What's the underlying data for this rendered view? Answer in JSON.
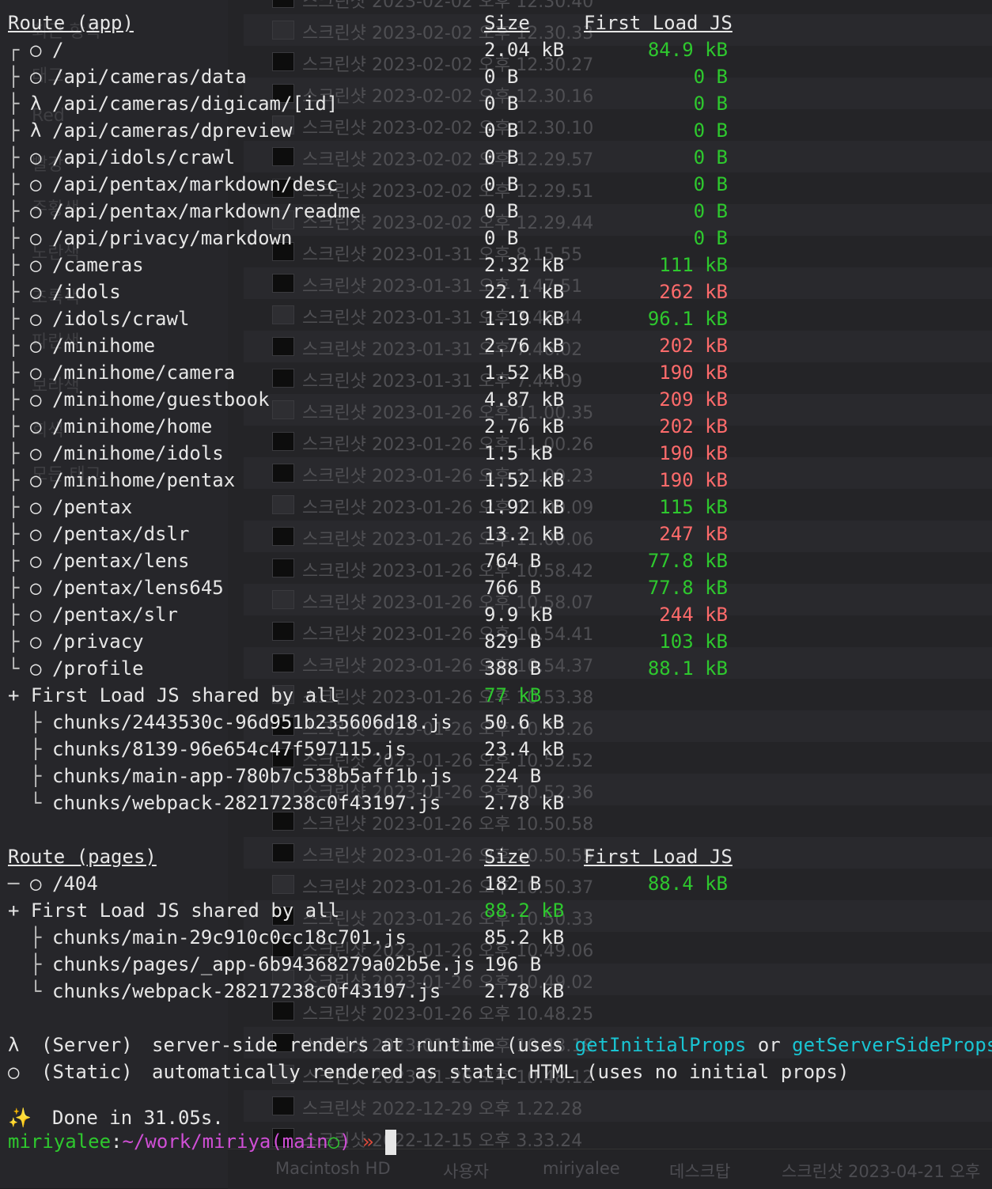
{
  "background_finder": {
    "rows": [
      "스크린샷 2023-02-02 오후 12.30.40",
      "스크린샷 2023-02-02 오후 12.30.33",
      "스크린샷 2023-02-02 오후 12.30.27",
      "스크린샷 2023-02-02 오후 12.30.16",
      "스크린샷 2023-02-02 오후 12.30.10",
      "스크린샷 2023-02-02 오후 12.29.57",
      "스크린샷 2023-02-02 오후 12.29.51",
      "스크린샷 2023-02-02 오후 12.29.44",
      "스크린샷 2023-01-31 오후 8.15.55",
      "스크린샷 2023-01-31 오후 7.47.51",
      "스크린샷 2023-01-31 오후 7.46.44",
      "스크린샷 2023-01-31 오후 7.46.02",
      "스크린샷 2023-01-31 오후 7.44.09",
      "스크린샷 2023-01-26 오후 11.00.35",
      "스크린샷 2023-01-26 오후 11.00.26",
      "스크린샷 2023-01-26 오후 11.00.23",
      "스크린샷 2023-01-26 오후 11.00.09",
      "스크린샷 2023-01-26 오후 11.00.06",
      "스크린샷 2023-01-26 오후 10.58.42",
      "스크린샷 2023-01-26 오후 10.58.07",
      "스크린샷 2023-01-26 오후 10.54.41",
      "스크린샷 2023-01-26 오후 10.54.37",
      "스크린샷 2023-01-26 오후 10.53.38",
      "스크린샷 2023-01-26 오후 10.53.26",
      "스크린샷 2023-01-26 오후 10.52.52",
      "스크린샷 2023-01-26 오후 10.52.36",
      "스크린샷 2023-01-26 오후 10.50.58",
      "스크린샷 2023-01-26 오후 10.50.55",
      "스크린샷 2023-01-26 오후 10.50.37",
      "스크린샷 2023-01-26 오후 10.50.33",
      "스크린샷 2023-01-26 오후 10.49.06",
      "스크린샷 2023-01-26 오후 10.49.02",
      "스크린샷 2023-01-26 오후 10.48.25",
      "스크린샷 2023-01-26 오후 10.48.18",
      "스크린샷 2023-01-26 오후 10.48.12",
      "스크린샷 2022-12-29 오후 1.22.28",
      "스크린샷 2022-12-15 오후 3.33.24"
    ],
    "sidebar_items": [
      "최근 항목",
      "태그",
      "Red",
      "빨강",
      "주황색",
      "노란색",
      "초록색",
      "파란색",
      "보라색",
      "회색",
      "모든 태그"
    ],
    "path_bar": [
      "Macintosh HD",
      "사용자",
      "miriyalee",
      "데스크탑",
      "스크린샷 2023-04-21 오후"
    ]
  },
  "app_section": {
    "header": {
      "route": "Route (app)",
      "size": "Size",
      "first_load": "First Load JS"
    },
    "routes": [
      {
        "tree": "┌",
        "sym": "○",
        "path": "/",
        "size": "2.04 kB",
        "first": "84.9 kB",
        "color": "#2ec82e"
      },
      {
        "tree": "├",
        "sym": "○",
        "path": "/api/cameras/data",
        "size": "0 B",
        "first": "0 B",
        "color": "#2ec82e"
      },
      {
        "tree": "├",
        "sym": "λ",
        "path": "/api/cameras/digicam/[id]",
        "size": "0 B",
        "first": "0 B",
        "color": "#2ec82e"
      },
      {
        "tree": "├",
        "sym": "λ",
        "path": "/api/cameras/dpreview",
        "size": "0 B",
        "first": "0 B",
        "color": "#2ec82e"
      },
      {
        "tree": "├",
        "sym": "○",
        "path": "/api/idols/crawl",
        "size": "0 B",
        "first": "0 B",
        "color": "#2ec82e"
      },
      {
        "tree": "├",
        "sym": "○",
        "path": "/api/pentax/markdown/desc",
        "size": "0 B",
        "first": "0 B",
        "color": "#2ec82e"
      },
      {
        "tree": "├",
        "sym": "○",
        "path": "/api/pentax/markdown/readme",
        "size": "0 B",
        "first": "0 B",
        "color": "#2ec82e"
      },
      {
        "tree": "├",
        "sym": "○",
        "path": "/api/privacy/markdown",
        "size": "0 B",
        "first": "0 B",
        "color": "#2ec82e"
      },
      {
        "tree": "├",
        "sym": "○",
        "path": "/cameras",
        "size": "2.32 kB",
        "first": "111 kB",
        "color": "#2ec82e"
      },
      {
        "tree": "├",
        "sym": "○",
        "path": "/idols",
        "size": "22.1 kB",
        "first": "262 kB",
        "color": "#ff6b6b"
      },
      {
        "tree": "├",
        "sym": "○",
        "path": "/idols/crawl",
        "size": "1.19 kB",
        "first": "96.1 kB",
        "color": "#2ec82e"
      },
      {
        "tree": "├",
        "sym": "○",
        "path": "/minihome",
        "size": "2.76 kB",
        "first": "202 kB",
        "color": "#ff6b6b"
      },
      {
        "tree": "├",
        "sym": "○",
        "path": "/minihome/camera",
        "size": "1.52 kB",
        "first": "190 kB",
        "color": "#ff6b6b"
      },
      {
        "tree": "├",
        "sym": "○",
        "path": "/minihome/guestbook",
        "size": "4.87 kB",
        "first": "209 kB",
        "color": "#ff6b6b"
      },
      {
        "tree": "├",
        "sym": "○",
        "path": "/minihome/home",
        "size": "2.76 kB",
        "first": "202 kB",
        "color": "#ff6b6b"
      },
      {
        "tree": "├",
        "sym": "○",
        "path": "/minihome/idols",
        "size": "1.5 kB",
        "first": "190 kB",
        "color": "#ff6b6b"
      },
      {
        "tree": "├",
        "sym": "○",
        "path": "/minihome/pentax",
        "size": "1.52 kB",
        "first": "190 kB",
        "color": "#ff6b6b"
      },
      {
        "tree": "├",
        "sym": "○",
        "path": "/pentax",
        "size": "1.92 kB",
        "first": "115 kB",
        "color": "#2ec82e"
      },
      {
        "tree": "├",
        "sym": "○",
        "path": "/pentax/dslr",
        "size": "13.2 kB",
        "first": "247 kB",
        "color": "#ff6b6b"
      },
      {
        "tree": "├",
        "sym": "○",
        "path": "/pentax/lens",
        "size": "764 B",
        "first": "77.8 kB",
        "color": "#2ec82e"
      },
      {
        "tree": "├",
        "sym": "○",
        "path": "/pentax/lens645",
        "size": "766 B",
        "first": "77.8 kB",
        "color": "#2ec82e"
      },
      {
        "tree": "├",
        "sym": "○",
        "path": "/pentax/slr",
        "size": "9.9 kB",
        "first": "244 kB",
        "color": "#ff6b6b"
      },
      {
        "tree": "├",
        "sym": "○",
        "path": "/privacy",
        "size": "829 B",
        "first": "103 kB",
        "color": "#2ec82e"
      },
      {
        "tree": "└",
        "sym": "○",
        "path": "/profile",
        "size": "388 B",
        "first": "88.1 kB",
        "color": "#2ec82e"
      }
    ],
    "shared": {
      "label": "+ First Load JS shared by all",
      "size": "77 kB"
    },
    "chunks": [
      {
        "tree": "├",
        "name": "chunks/2443530c-96d951b235606d18.js",
        "size": "50.6 kB"
      },
      {
        "tree": "├",
        "name": "chunks/8139-96e654c47f597115.js",
        "size": "23.4 kB"
      },
      {
        "tree": "├",
        "name": "chunks/main-app-780b7c538b5aff1b.js",
        "size": "224 B"
      },
      {
        "tree": "└",
        "name": "chunks/webpack-28217238c0f43197.js",
        "size": "2.78 kB"
      }
    ]
  },
  "pages_section": {
    "header": {
      "route": "Route (pages)",
      "size": "Size",
      "first_load": "First Load JS"
    },
    "routes": [
      {
        "tree": "─",
        "sym": "○",
        "path": "/404",
        "size": "182 B",
        "first": "88.4 kB",
        "color": "#2ec82e"
      }
    ],
    "shared": {
      "label": "+ First Load JS shared by all",
      "size": "88.2 kB"
    },
    "chunks": [
      {
        "tree": "├",
        "name": "chunks/main-29c910c0cc18c701.js",
        "size": "85.2 kB"
      },
      {
        "tree": "├",
        "name": "chunks/pages/_app-6b94368279a02b5e.js",
        "size": "196 B"
      },
      {
        "tree": "└",
        "name": "chunks/webpack-28217238c0f43197.js",
        "size": "2.78 kB"
      }
    ]
  },
  "legend": {
    "server_sym": "λ",
    "server_label": "(Server)",
    "server_text_a": "server-side renders at runtime (uses ",
    "server_fn1": "getInitialProps",
    "server_text_b": " or ",
    "server_fn2": "getServerSideProps",
    "server_text_c": ")",
    "static_sym": "○",
    "static_label": "(Static)",
    "static_text": "automatically rendered as static HTML (uses no initial props)"
  },
  "done": {
    "icon": "✨",
    "text": "Done in 31.05s."
  },
  "prompt": {
    "user": "miriyalee",
    "sep": ":",
    "path": "~/work/miriya",
    "branch_open": "(",
    "branch": "main",
    "branch_mark": "○",
    "branch_close": ")",
    "arrow": "»"
  },
  "colors": {
    "ok": "#2ec82e",
    "warn": "#ff6b6b",
    "cyan": "#19c4d2",
    "user": "#2ec82e",
    "path": "#d04fd6"
  }
}
